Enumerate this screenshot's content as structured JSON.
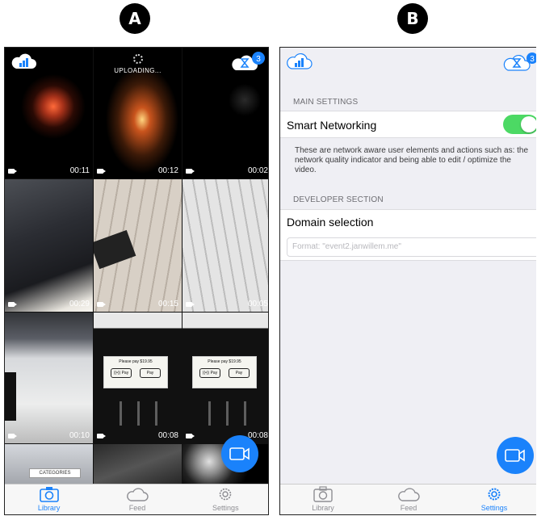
{
  "labels": {
    "left": "A",
    "right": "B"
  },
  "library": {
    "uploading_text": "UPLOADING...",
    "durations": [
      "00:11",
      "00:12",
      "00:02",
      "00:29",
      "00:15",
      "00:05",
      "00:10",
      "00:08",
      "00:08"
    ],
    "terminal_text": "Please pay $19.95",
    "terminal_button_1": "((•)) Pay",
    "terminal_button_2": "Pay",
    "categories_text": "CATEGORIES",
    "upload_queue_count": "3"
  },
  "tabs": [
    {
      "label": "Library",
      "icon": "photo-camera-icon"
    },
    {
      "label": "Feed",
      "icon": "cloud-icon"
    },
    {
      "label": "Settings",
      "icon": "gear-icon"
    }
  ],
  "settings": {
    "main_section": "MAIN SETTINGS",
    "smart_networking_label": "Smart Networking",
    "smart_networking_on": true,
    "description": "These are network aware user elements and actions such as: the network quality indicator and being able to edit / optimize the video.",
    "developer_section": "DEVELOPER SECTION",
    "domain_label": "Domain selection",
    "domain_placeholder": "Format: \"event2.janwillem.me\"",
    "upload_queue_count": "3"
  },
  "colors": {
    "accent": "#1a82fb",
    "toggle_on": "#4cd964",
    "background": "#efeff4"
  }
}
